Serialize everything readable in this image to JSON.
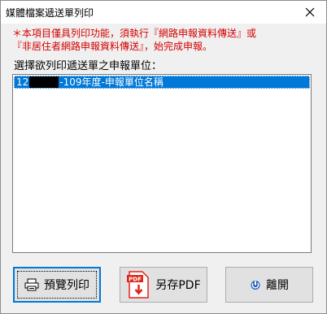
{
  "window": {
    "title": "媒體檔案遞送單列印"
  },
  "notice": {
    "line1": "＊本項目僅具列印功能，須執行『網路申報資料傳送』或",
    "line2": "『非居住者網路申報資料傳送』，始完成申報。"
  },
  "select_label": "選擇欲列印遞送單之申報單位：",
  "list": {
    "items": [
      {
        "prefix": "12",
        "suffix": "-109年度-申報單位名稱"
      }
    ]
  },
  "buttons": {
    "preview_print": "預覽列印",
    "save_pdf": "另存PDF",
    "pdf_badge": "PDF",
    "exit": "離開"
  },
  "colors": {
    "selection": "#0078d7",
    "notice": "#d40000",
    "exit_icon": "#1f5fbf",
    "pdf_icon": "#e1251b"
  }
}
